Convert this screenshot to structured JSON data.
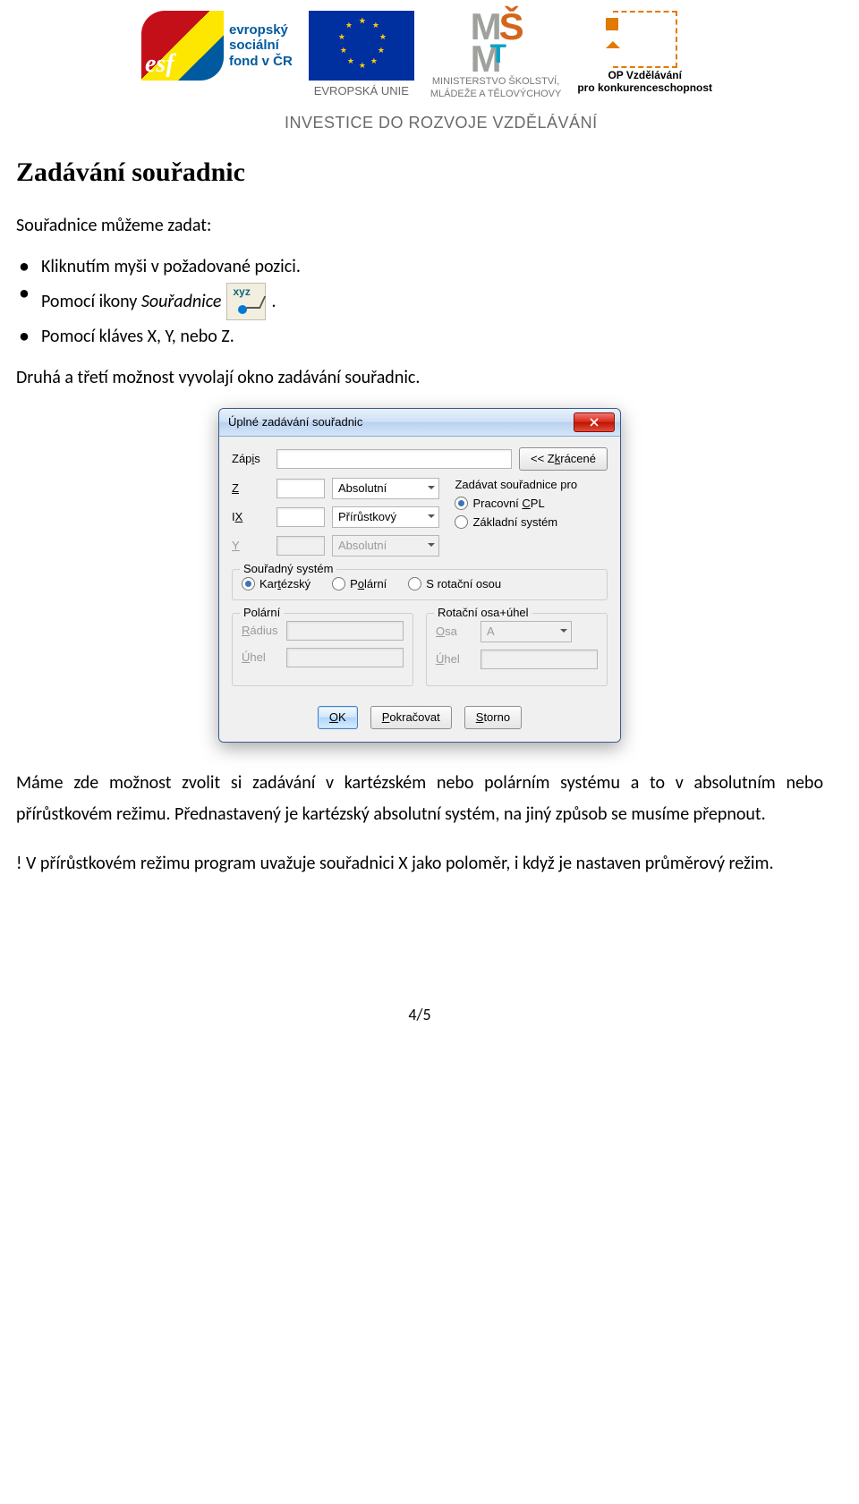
{
  "header": {
    "esf_line1": "evropský",
    "esf_line2": "sociální",
    "esf_line3": "fond v ČR",
    "esf_mark": "esf",
    "eu_label": "EVROPSKÁ UNIE",
    "msmt_line1": "MINISTERSTVO ŠKOLSTVÍ,",
    "msmt_line2": "MLÁDEŽE A TĚLOVÝCHOVY",
    "opvk_line1": "OP Vzdělávání",
    "opvk_line2": "pro konkurenceschopnost",
    "motto": "INVESTICE DO ROZVOJE VZDĚLÁVÁNÍ"
  },
  "doc": {
    "title": "Zadávání souřadnic",
    "intro": "Souřadnice můžeme zadat:",
    "bullet1": "Kliknutím myši v požadované pozici.",
    "bullet2_pre": "Pomocí ikony ",
    "bullet2_italic": "Souřadnice",
    "bullet2_post": ".",
    "bullet3": "Pomocí kláves X, Y, nebo Z.",
    "after_bullets": "Druhá a třetí možnost vyvolají okno zadávání souřadnic.",
    "para1": "Máme zde možnost zvolit si zadávání v kartézském nebo polárním systému a to v absolutním nebo přírůstkovém režimu. Přednastavený je kartézský absolutní systém, na jiný způsob se musíme přepnout.",
    "para2": "! V přírůstkovém režimu program uvažuje souřadnici X jako poloměr, i když je nastaven průměrový režim.",
    "page_num": "4/5",
    "xyz_label": "xyz"
  },
  "dialog": {
    "title": "Úplné zadávání souřadnic",
    "zapis_lbl": "Zápis",
    "zapis_u": "i",
    "zkracene_btn": "<< Zkrácené",
    "zkracene_u": "k",
    "z_lbl": "Z",
    "ix_lbl": "IX",
    "y_lbl": "Y",
    "mode_abs": "Absolutní",
    "mode_inc": "Přírůstkový",
    "side_title": "Zadávat souřadnice pro",
    "side_opt1": "Pracovní CPL",
    "side_opt1_u": "C",
    "side_opt2": "Základní systém",
    "cs_title": "Souřadný systém",
    "cs_opt1": "Kartézský",
    "cs_opt1_u": "t",
    "cs_opt2": "Polární",
    "cs_opt2_u": "o",
    "cs_opt3": "S rotační osou",
    "polar_title": "Polární",
    "polar_radius": "Rádius",
    "polar_radius_u": "R",
    "polar_angle": "Úhel",
    "polar_angle_u": "Ú",
    "rot_title": "Rotační osa+úhel",
    "rot_axis": "Osa",
    "rot_axis_u": "O",
    "rot_axis_val": "A",
    "rot_angle": "Úhel",
    "rot_angle_u": "Ú",
    "btn_ok": "OK",
    "btn_ok_u": "O",
    "btn_cont": "Pokračovat",
    "btn_cont_u": "P",
    "btn_cancel": "Storno",
    "btn_cancel_u": "S"
  }
}
